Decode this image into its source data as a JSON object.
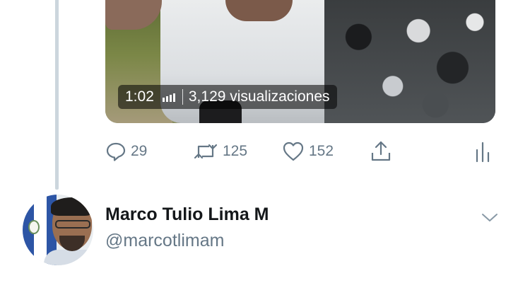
{
  "video": {
    "duration": "1:02",
    "views": "3,129 visualizaciones"
  },
  "actions": {
    "reply": {
      "icon": "reply-icon",
      "count": "29"
    },
    "retweet": {
      "icon": "retweet-icon",
      "count": "125"
    },
    "like": {
      "icon": "heart-icon",
      "count": "152"
    },
    "share": {
      "icon": "share-icon"
    },
    "analytics": {
      "icon": "analytics-icon"
    }
  },
  "author": {
    "display_name": "Marco Tulio Lima M",
    "handle": "@marcotlimam"
  },
  "colors": {
    "thread_line": "#ccd6dd",
    "secondary_text": "#657786",
    "primary_text": "#14171a"
  }
}
